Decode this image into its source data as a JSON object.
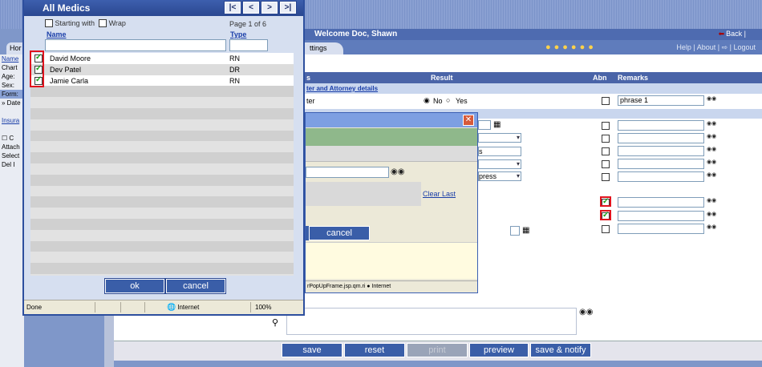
{
  "background_app": {
    "welcome": "Welcome Doc, Shawn",
    "back_link": "Back |",
    "toolbar_links": "Help | About | ⇨ | Logout",
    "tab_home": "Hor",
    "tab_settings": "ttings",
    "left_strip": [
      "Name",
      "Chart",
      "Age:",
      "Sex:",
      "Form:",
      "» Date",
      "",
      "Insura",
      "",
      "☐ C",
      "Attach",
      "Select",
      "Del  I"
    ],
    "grid_headers": {
      "col1": "s",
      "result": "Result",
      "abn": "Abn",
      "remarks": "Remarks"
    },
    "section_link": "ter and Attorney details",
    "row1": {
      "label": "ter",
      "radio_no": "No",
      "radio_yes": "Yes",
      "remark": "phrase 1"
    },
    "abn_checked": [
      false,
      false,
      false,
      false,
      false,
      false,
      true,
      true,
      false
    ],
    "popup": {
      "clear_last": "Clear Last",
      "cancel": "cancel",
      "status_text": "rPopUpFrame.jsp.qm.ri ● Internet",
      "field_frags": [
        "s",
        "press"
      ]
    },
    "buttons": {
      "save": "save",
      "reset": "reset",
      "print": "print",
      "preview": "preview",
      "save_notify": "save & notify"
    }
  },
  "medics_popup": {
    "title": "All Medics",
    "nav": {
      "first": "|<",
      "prev": "<",
      "next": ">",
      "last": ">|"
    },
    "options": {
      "starting_with": "Starting with",
      "wrap": "Wrap"
    },
    "page_label": "Page 1 of 6",
    "columns": {
      "name": "Name",
      "type": "Type"
    },
    "rows": [
      {
        "name": "David Moore",
        "type": "RN",
        "checked": true
      },
      {
        "name": "Dev Patel",
        "type": "DR",
        "checked": true
      },
      {
        "name": "Jamie Carla",
        "type": "RN",
        "checked": true
      }
    ],
    "empty_rows": 18,
    "ok": "ok",
    "cancel": "cancel",
    "status": {
      "done": "Done",
      "zone": "Internet",
      "zoom": "100%"
    }
  },
  "colors": {
    "highlight_frame": "#e0141e",
    "button_blue": "#3a5ea8",
    "titlebar": "#2a4790"
  }
}
